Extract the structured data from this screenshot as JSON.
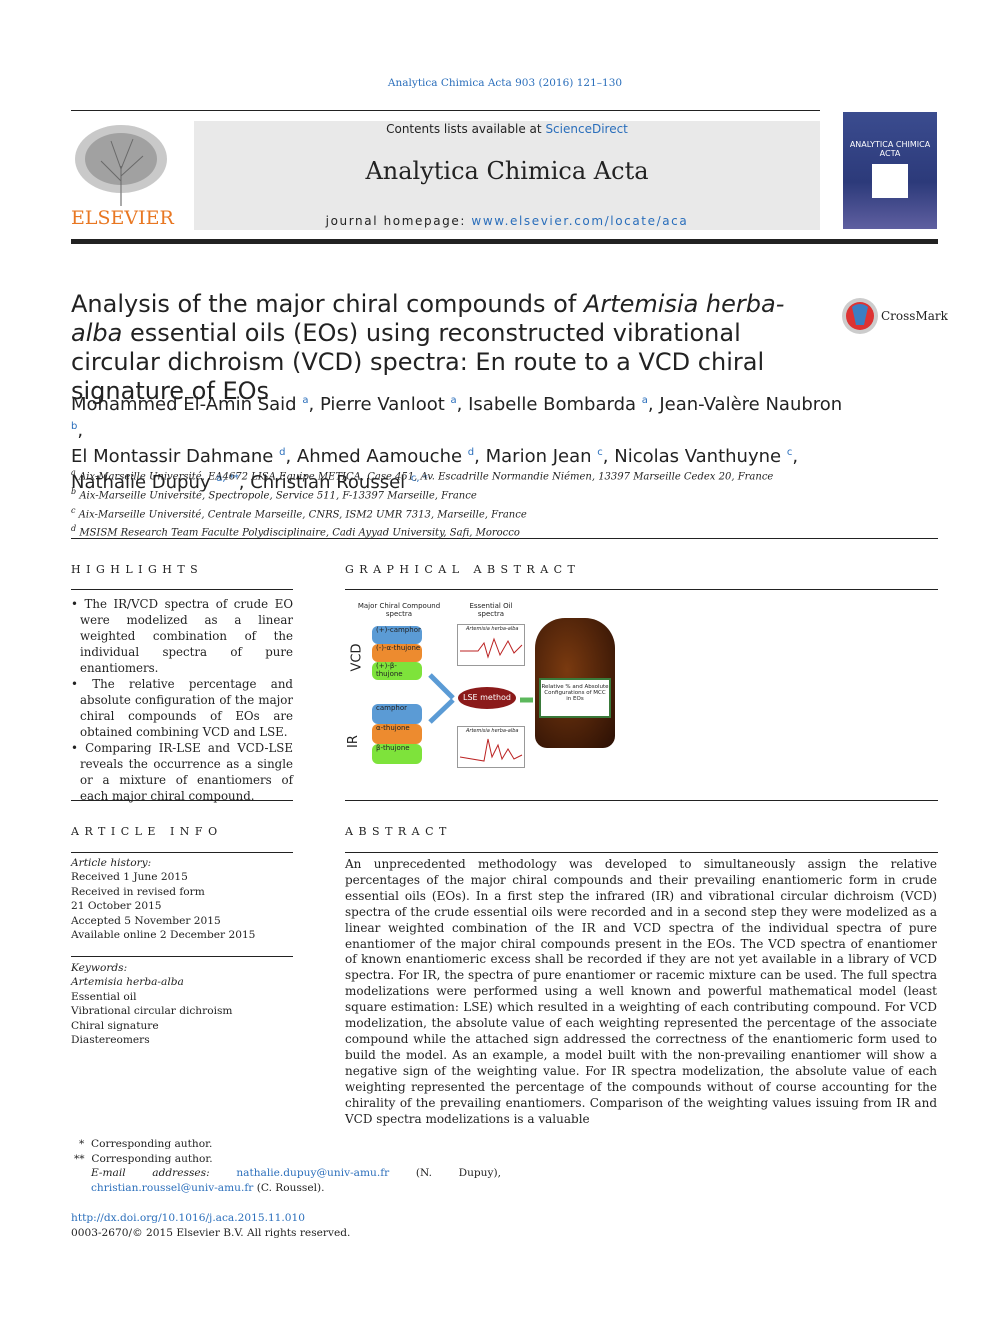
{
  "journal_ref": "Analytica Chimica Acta 903 (2016) 121–130",
  "banner": {
    "contents_prefix": "Contents lists available at ",
    "contents_link": "ScienceDirect",
    "journal": "Analytica Chimica Acta",
    "homepage_prefix": "journal homepage: ",
    "homepage_link": "www.elsevier.com/locate/aca"
  },
  "publisher": "ELSEVIER",
  "cover_title": "ANALYTICA CHIMICA ACTA",
  "crossmark": "CrossMark",
  "title_parts": [
    "Analysis of the major chiral compounds of ",
    "Artemisia herba-alba",
    " essential oils (EOs) using reconstructed vibrational circular dichroism (VCD) spectra: En route to a VCD chiral signature of EOs"
  ],
  "authors": [
    {
      "name": "Mohammed El-Amin Said",
      "sup": "a"
    },
    {
      "name": "Pierre Vanloot",
      "sup": "a"
    },
    {
      "name": "Isabelle Bombarda",
      "sup": "a"
    },
    {
      "name": "Jean-Valère Naubron",
      "sup": "b"
    },
    {
      "name": "El Montassir Dahmane",
      "sup": "d"
    },
    {
      "name": "Ahmed Aamouche",
      "sup": "d"
    },
    {
      "name": "Marion Jean",
      "sup": "c"
    },
    {
      "name": "Nicolas Vanthuyne",
      "sup": "c"
    },
    {
      "name": "Nathalie Dupuy",
      "sup": "a, **"
    },
    {
      "name": "Christian Roussel",
      "sup": "c, *"
    }
  ],
  "affiliations": [
    {
      "key": "a",
      "text": "Aix-Marseille Université, EA4672 LISA Equipe METICA, Case 451, Av. Escadrille Normandie Niémen, 13397 Marseille Cedex 20, France"
    },
    {
      "key": "b",
      "text": "Aix-Marseille Université, Spectropole, Service 511, F-13397 Marseille, France"
    },
    {
      "key": "c",
      "text": "Aix-Marseille Université, Centrale Marseille, CNRS, ISM2 UMR 7313, Marseille, France"
    },
    {
      "key": "d",
      "text": "MSISM Research Team Faculte Polydisciplinaire, Cadi Ayyad University, Safi, Morocco"
    }
  ],
  "highlights": {
    "heading": "HIGHLIGHTS",
    "items": [
      "The IR/VCD spectra of crude EO were modelized as a linear weighted combination of the individual spectra of pure enantiomers.",
      "The relative percentage and absolute configuration of the major chiral compounds of EOs are obtained combining VCD and LSE.",
      "Comparing IR-LSE and VCD-LSE reveals the occurrence as a single or a mixture of enantiomers of each major chiral compound."
    ]
  },
  "graphical_abstract": {
    "heading": "GRAPHICAL ABSTRACT",
    "col1": "Major Chiral Compound spectra",
    "col2": "Essential Oil spectra",
    "vcd": "VCD",
    "ir": "IR",
    "vcd_layers": [
      "(+)-camphor",
      "(-)-α-thujone",
      "(+)-β-thujone"
    ],
    "ir_layers": [
      "camphor",
      "α-thujone",
      "β-thujone"
    ],
    "spectrum_label": "Artemisia herba-alba",
    "method": "LSE method",
    "result": "Relative % and Absolute Configurations of MCC in EOs"
  },
  "article_info": {
    "heading": "ARTICLE INFO",
    "history_label": "Article history:",
    "history": [
      "Received 1 June 2015",
      "Received in revised form",
      "21 October 2015",
      "Accepted 5 November 2015",
      "Available online 2 December 2015"
    ],
    "keywords_label": "Keywords:",
    "keywords": [
      "Artemisia herba-alba",
      "Essential oil",
      "Vibrational circular dichroism",
      "Chiral signature",
      "Diastereomers"
    ]
  },
  "abstract": {
    "heading": "ABSTRACT",
    "text": "An unprecedented methodology was developed to simultaneously assign the relative percentages of the major chiral compounds and their prevailing enantiomeric form in crude essential oils (EOs). In a first step the infrared (IR) and vibrational circular dichroism (VCD) spectra of the crude essential oils were recorded and in a second step they were modelized as a linear weighted combination of the IR and VCD spectra of the individual spectra of pure enantiomer of the major chiral compounds present in the EOs. The VCD spectra of enantiomer of known enantiomeric excess shall be recorded if they are not yet available in a library of VCD spectra. For IR, the spectra of pure enantiomer or racemic mixture can be used. The full spectra modelizations were performed using a well known and powerful mathematical model (least square estimation: LSE) which resulted in a weighting of each contributing compound. For VCD modelization, the absolute value of each weighting represented the percentage of the associate compound while the attached sign addressed the correctness of the enantiomeric form used to build the model. As an example, a model built with the non-prevailing enantiomer will show a negative sign of the weighting value. For IR spectra modelization, the absolute value of each weighting represented the percentage of the compounds without of course accounting for the chirality of the prevailing enantiomers. Comparison of the weighting values issuing from IR and VCD spectra modelizations is a valuable"
  },
  "footnotes": {
    "star": "*",
    "star_text": "Corresponding author.",
    "dstar": "**",
    "dstar_text": "Corresponding author.",
    "email_label": "E-mail addresses:",
    "email1": "nathalie.dupuy@univ-amu.fr",
    "email1_who": "(N. Dupuy),",
    "email2": "christian.roussel@univ-amu.fr",
    "email2_who": "(C. Roussel).",
    "doi": "http://dx.doi.org/10.1016/j.aca.2015.11.010",
    "copyright": "0003-2670/© 2015 Elsevier B.V. All rights reserved."
  }
}
